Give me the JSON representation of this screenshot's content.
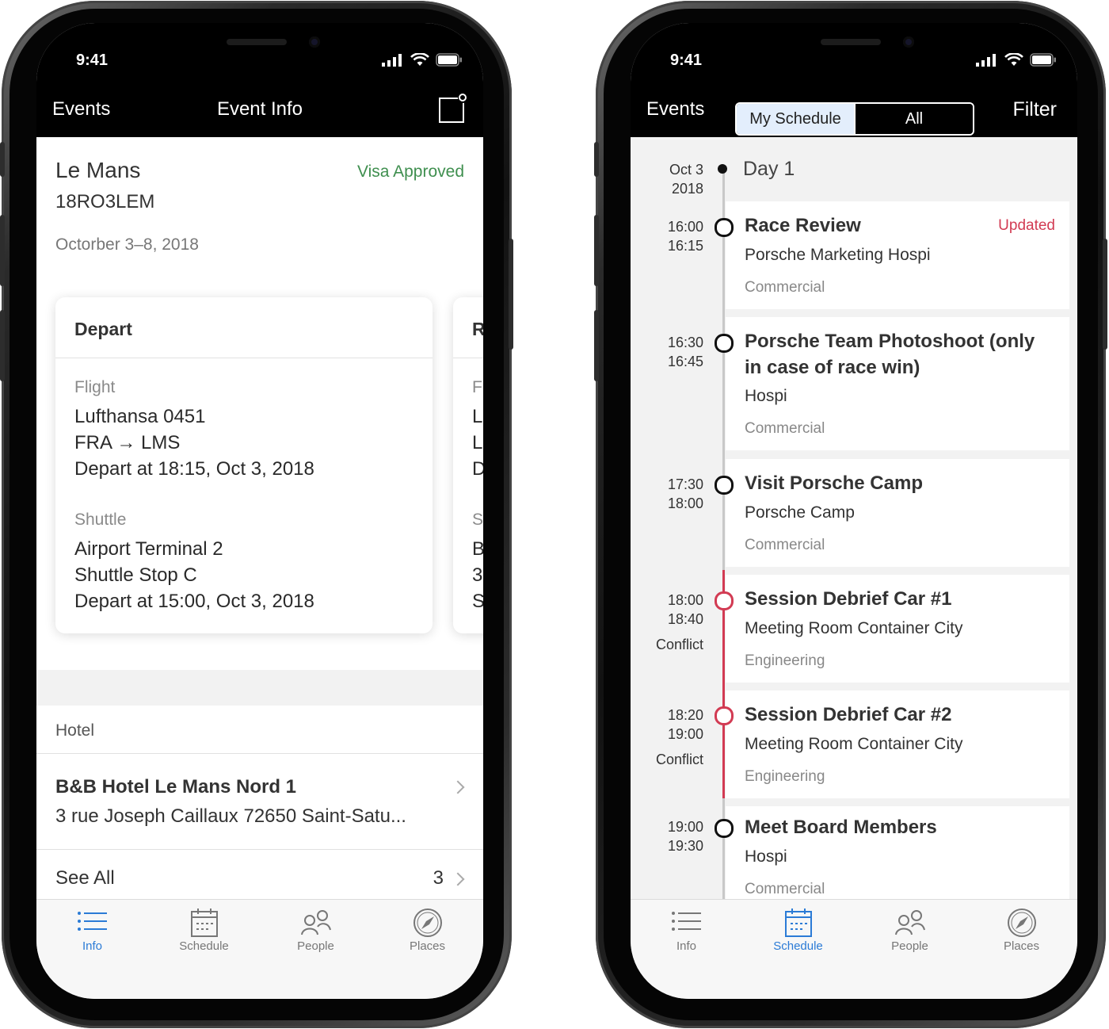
{
  "status_time": "9:41",
  "left": {
    "nav": {
      "back": "Events",
      "title": "Event Info"
    },
    "event": {
      "name": "Le Mans",
      "code": "18RO3LEM",
      "visa": "Visa Approved",
      "dates": "Octorber 3–8, 2018"
    },
    "depart_card": {
      "title": "Depart",
      "flight_label": "Flight",
      "flight_lines": [
        "Lufthansa 0451",
        "FRA → LMS",
        "Depart at 18:15, Oct 3, 2018"
      ],
      "shuttle_label": "Shuttle",
      "shuttle_lines": [
        "Airport Terminal 2",
        "Shuttle Stop C",
        "Depart at 15:00, Oct 3, 2018"
      ]
    },
    "return_card": {
      "title": "R",
      "flight_label": "F",
      "flight_lines": [
        "L",
        "L",
        "D"
      ],
      "shuttle_label": "S",
      "shuttle_lines": [
        "B",
        "3",
        "S"
      ]
    },
    "hotel": {
      "section_label": "Hotel",
      "name": "B&B Hotel Le Mans Nord 1",
      "address": "3 rue Joseph Caillaux 72650 Saint-Satu...",
      "see_all": "See All",
      "count": "3"
    },
    "tabs": [
      "Info",
      "Schedule",
      "People",
      "Places"
    ],
    "active_tab": "Info"
  },
  "right": {
    "nav": {
      "back": "Events",
      "seg_on": "My Schedule",
      "seg_off": "All",
      "filter": "Filter"
    },
    "day": {
      "date": "Oct 3",
      "year": "2018",
      "label": "Day 1"
    },
    "items": [
      {
        "start": "16:00",
        "end": "16:15",
        "title": "Race Review",
        "location": "Porsche Marketing Hospi",
        "category": "Commercial",
        "badge": "Updated"
      },
      {
        "start": "16:30",
        "end": "16:45",
        "title": "Porsche Team Photoshoot (only",
        "title2": "in case of race win)",
        "location": "Hospi",
        "category": "Commercial"
      },
      {
        "start": "17:30",
        "end": "18:00",
        "title": "Visit Porsche Camp",
        "location": "Porsche Camp",
        "category": "Commercial"
      },
      {
        "start": "18:00",
        "end": "18:40",
        "conflict": "Conflict",
        "title": "Session Debrief Car #1",
        "location": "Meeting Room Container City",
        "category": "Engineering"
      },
      {
        "start": "18:20",
        "end": "19:00",
        "conflict": "Conflict",
        "title": "Session Debrief Car #2",
        "location": "Meeting Room Container City",
        "category": "Engineering"
      },
      {
        "start": "19:00",
        "end": "19:30",
        "title": "Meet Board Members",
        "location": "Hospi",
        "category": "Commercial"
      }
    ],
    "tabs": [
      "Info",
      "Schedule",
      "People",
      "Places"
    ],
    "active_tab": "Schedule",
    "colors": {
      "conflict": "#d23b53",
      "accent": "#2b7bd6",
      "visa": "#3f8f4f"
    }
  }
}
